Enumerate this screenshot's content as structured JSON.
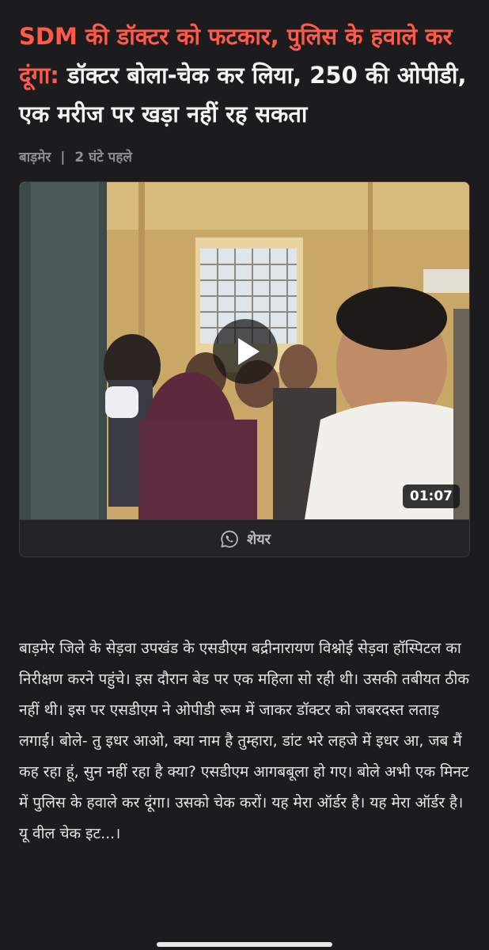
{
  "article": {
    "headline_highlight": "SDM की डॉक्टर को फटकार, पुलिस के हवाले कर दूंगा:",
    "headline_rest": " डॉक्टर बोला-चेक कर लिया, 250 की ओपीडी, एक मरीज पर खड़ा नहीं रह सकता",
    "location": "बाड़मेर",
    "separator": "|",
    "time_ago": "2 घंटे पहले",
    "body": "बाड़मेर जिले के सेड़वा उपखंड के एसडीएम बद्रीनारायण विश्नोई सेड़वा हॉस्पिटल का निरीक्षण करने पहुंचे। इस दौरान बेड पर एक महिला सो रही थी। उसकी तबीयत ठीक नहीं थी। इस पर एसडीएम ने ओपीडी रूम में जाकर डॉक्टर को जबरदस्त लताड़ लगाई। बोले- तु इधर आओ, क्या नाम है तुम्हारा, डांट भरे लहजे में इधर आ, जब मैं कह रहा हूं, सुन नहीं रहा है क्या? एसडीएम आगबबूला हो गए। बोले अभी एक मिनट में पुलिस के हवाले कर दूंगा। उसको चेक करों। यह मेरा ऑर्डर है। यह मेरा ऑर्डर है। यू वील चेक इट...।"
  },
  "video": {
    "duration": "01:07",
    "play_icon": "play-icon"
  },
  "share": {
    "label": "शेयर",
    "icon": "whatsapp-icon"
  },
  "colors": {
    "background": "#1c1c1e",
    "headline_accent": "#ff5a4a",
    "meta_text": "#8e8e93"
  }
}
